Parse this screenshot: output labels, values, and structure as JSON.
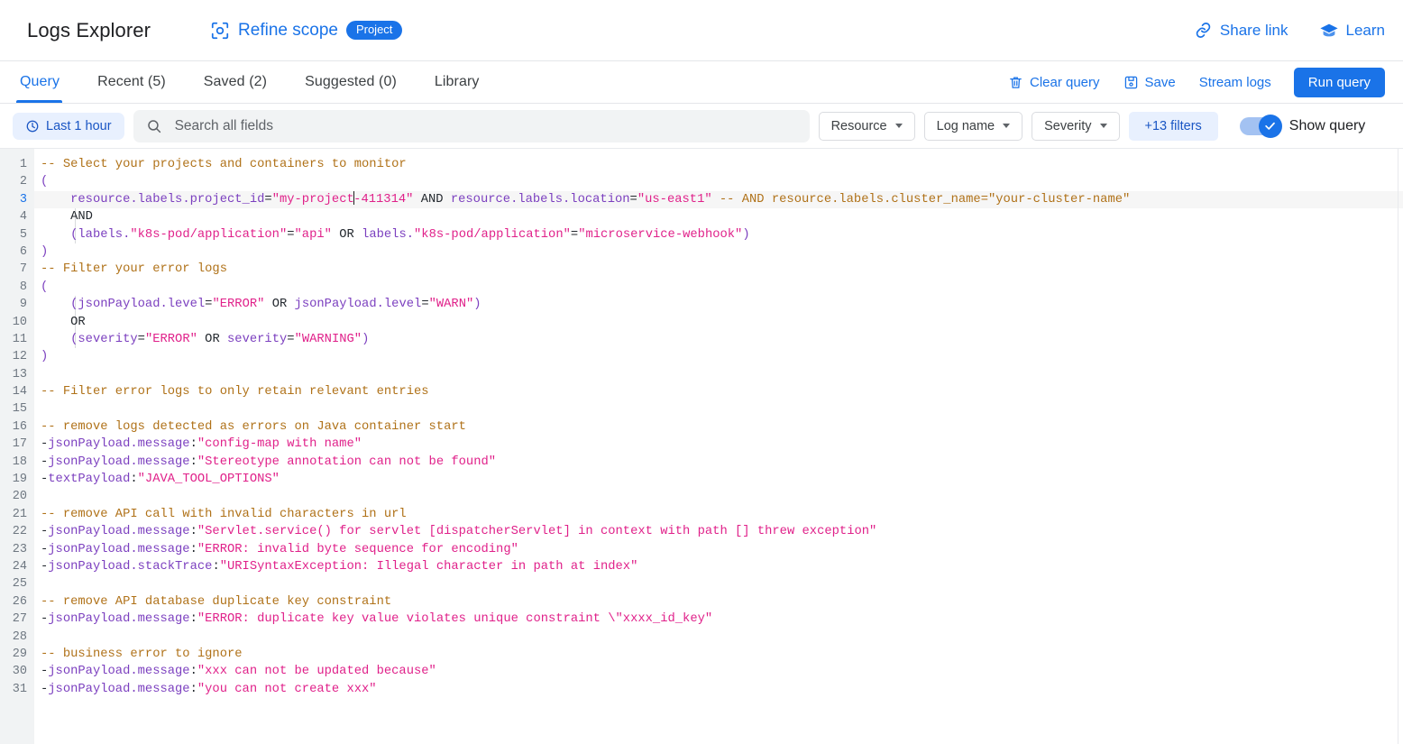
{
  "header": {
    "app_title": "Logs Explorer",
    "refine_scope_label": "Refine scope",
    "refine_scope_icon": "focus-target-icon",
    "scope_chip": "Project",
    "share_link": "Share link",
    "share_link_icon": "link-icon",
    "learn": "Learn",
    "learn_icon": "graduation-cap-icon"
  },
  "tabbar": {
    "tabs": [
      {
        "label": "Query",
        "active": true
      },
      {
        "label": "Recent (5)",
        "active": false
      },
      {
        "label": "Saved (2)",
        "active": false
      },
      {
        "label": "Suggested (0)",
        "active": false
      },
      {
        "label": "Library",
        "active": false
      }
    ],
    "clear_query": "Clear query",
    "clear_query_icon": "trash-icon",
    "save": "Save",
    "save_icon": "save-disk-icon",
    "stream_logs": "Stream logs",
    "run_query": "Run query"
  },
  "filterbar": {
    "time_range": "Last 1 hour",
    "time_range_icon": "clock-icon",
    "search_placeholder": "Search all fields",
    "search_value": "",
    "search_icon": "search-icon",
    "resource": "Resource",
    "log_name": "Log name",
    "severity": "Severity",
    "more_filters": "+13 filters",
    "show_query_label": "Show query",
    "show_query_on": true
  },
  "colors": {
    "accent": "#1a73e8",
    "chip_bg": "#e8f0fe",
    "comment": "#b07219",
    "field": "#7b3fbf",
    "string": "#e0218a",
    "gutter_bg": "#f1f3f4"
  },
  "editor": {
    "active_line": 3,
    "total_lines": 31,
    "lines": [
      {
        "n": 1,
        "tokens": [
          {
            "t": "comment",
            "v": "-- Select your projects and containers to monitor"
          }
        ]
      },
      {
        "n": 2,
        "tokens": [
          {
            "t": "paren",
            "v": "("
          }
        ]
      },
      {
        "n": 3,
        "tokens": [
          {
            "t": "op",
            "v": "    "
          },
          {
            "t": "field",
            "v": "resource.labels.project_id"
          },
          {
            "t": "op",
            "v": "="
          },
          {
            "t": "string",
            "v": "\"my-project"
          },
          {
            "t": "caret",
            "v": ""
          },
          {
            "t": "string",
            "v": "-411314\""
          },
          {
            "t": "op",
            "v": " AND "
          },
          {
            "t": "field",
            "v": "resource.labels.location"
          },
          {
            "t": "op",
            "v": "="
          },
          {
            "t": "string",
            "v": "\"us-east1\""
          },
          {
            "t": "op",
            "v": " "
          },
          {
            "t": "comment",
            "v": "-- AND resource.labels.cluster_name=\"your-cluster-name\""
          }
        ]
      },
      {
        "n": 4,
        "tokens": [
          {
            "t": "op",
            "v": "    AND"
          }
        ]
      },
      {
        "n": 5,
        "tokens": [
          {
            "t": "op",
            "v": "    "
          },
          {
            "t": "paren",
            "v": "("
          },
          {
            "t": "field",
            "v": "labels."
          },
          {
            "t": "string",
            "v": "\"k8s-pod/application\""
          },
          {
            "t": "op",
            "v": "="
          },
          {
            "t": "string",
            "v": "\"api\""
          },
          {
            "t": "op",
            "v": " OR "
          },
          {
            "t": "field",
            "v": "labels."
          },
          {
            "t": "string",
            "v": "\"k8s-pod/application\""
          },
          {
            "t": "op",
            "v": "="
          },
          {
            "t": "string",
            "v": "\"microservice-webhook\""
          },
          {
            "t": "paren",
            "v": ")"
          }
        ]
      },
      {
        "n": 6,
        "tokens": [
          {
            "t": "paren",
            "v": ")"
          }
        ]
      },
      {
        "n": 7,
        "tokens": [
          {
            "t": "comment",
            "v": "-- Filter your error logs"
          }
        ]
      },
      {
        "n": 8,
        "tokens": [
          {
            "t": "paren",
            "v": "("
          }
        ]
      },
      {
        "n": 9,
        "tokens": [
          {
            "t": "op",
            "v": "    "
          },
          {
            "t": "paren",
            "v": "("
          },
          {
            "t": "field",
            "v": "jsonPayload.level"
          },
          {
            "t": "op",
            "v": "="
          },
          {
            "t": "string",
            "v": "\"ERROR\""
          },
          {
            "t": "op",
            "v": " OR "
          },
          {
            "t": "field",
            "v": "jsonPayload.level"
          },
          {
            "t": "op",
            "v": "="
          },
          {
            "t": "string",
            "v": "\"WARN\""
          },
          {
            "t": "paren",
            "v": ")"
          }
        ]
      },
      {
        "n": 10,
        "tokens": [
          {
            "t": "op",
            "v": "    OR"
          }
        ]
      },
      {
        "n": 11,
        "tokens": [
          {
            "t": "op",
            "v": "    "
          },
          {
            "t": "paren",
            "v": "("
          },
          {
            "t": "field",
            "v": "severity"
          },
          {
            "t": "op",
            "v": "="
          },
          {
            "t": "string",
            "v": "\"ERROR\""
          },
          {
            "t": "op",
            "v": " OR "
          },
          {
            "t": "field",
            "v": "severity"
          },
          {
            "t": "op",
            "v": "="
          },
          {
            "t": "string",
            "v": "\"WARNING\""
          },
          {
            "t": "paren",
            "v": ")"
          }
        ]
      },
      {
        "n": 12,
        "tokens": [
          {
            "t": "paren",
            "v": ")"
          }
        ]
      },
      {
        "n": 13,
        "tokens": []
      },
      {
        "n": 14,
        "tokens": [
          {
            "t": "comment",
            "v": "-- Filter error logs to only retain relevant entries"
          }
        ]
      },
      {
        "n": 15,
        "tokens": []
      },
      {
        "n": 16,
        "tokens": [
          {
            "t": "comment",
            "v": "-- remove logs detected as errors on Java container start"
          }
        ]
      },
      {
        "n": 17,
        "tokens": [
          {
            "t": "op",
            "v": "-"
          },
          {
            "t": "field",
            "v": "jsonPayload.message"
          },
          {
            "t": "op",
            "v": ":"
          },
          {
            "t": "string",
            "v": "\"config-map with name\""
          }
        ]
      },
      {
        "n": 18,
        "tokens": [
          {
            "t": "op",
            "v": "-"
          },
          {
            "t": "field",
            "v": "jsonPayload.message"
          },
          {
            "t": "op",
            "v": ":"
          },
          {
            "t": "string",
            "v": "\"Stereotype annotation can not be found\""
          }
        ]
      },
      {
        "n": 19,
        "tokens": [
          {
            "t": "op",
            "v": "-"
          },
          {
            "t": "field",
            "v": "textPayload"
          },
          {
            "t": "op",
            "v": ":"
          },
          {
            "t": "string",
            "v": "\"JAVA_TOOL_OPTIONS\""
          }
        ]
      },
      {
        "n": 20,
        "tokens": []
      },
      {
        "n": 21,
        "tokens": [
          {
            "t": "comment",
            "v": "-- remove API call with invalid characters in url"
          }
        ]
      },
      {
        "n": 22,
        "tokens": [
          {
            "t": "op",
            "v": "-"
          },
          {
            "t": "field",
            "v": "jsonPayload.message"
          },
          {
            "t": "op",
            "v": ":"
          },
          {
            "t": "string",
            "v": "\"Servlet.service() for servlet [dispatcherServlet] in context with path [] threw exception\""
          }
        ]
      },
      {
        "n": 23,
        "tokens": [
          {
            "t": "op",
            "v": "-"
          },
          {
            "t": "field",
            "v": "jsonPayload.message"
          },
          {
            "t": "op",
            "v": ":"
          },
          {
            "t": "string",
            "v": "\"ERROR: invalid byte sequence for encoding\""
          }
        ]
      },
      {
        "n": 24,
        "tokens": [
          {
            "t": "op",
            "v": "-"
          },
          {
            "t": "field",
            "v": "jsonPayload.stackTrace"
          },
          {
            "t": "op",
            "v": ":"
          },
          {
            "t": "string",
            "v": "\"URISyntaxException: Illegal character in path at index\""
          }
        ]
      },
      {
        "n": 25,
        "tokens": []
      },
      {
        "n": 26,
        "tokens": [
          {
            "t": "comment",
            "v": "-- remove API database duplicate key constraint"
          }
        ]
      },
      {
        "n": 27,
        "tokens": [
          {
            "t": "op",
            "v": "-"
          },
          {
            "t": "field",
            "v": "jsonPayload.message"
          },
          {
            "t": "op",
            "v": ":"
          },
          {
            "t": "string",
            "v": "\"ERROR: duplicate key value violates unique constraint \\\"xxxx_id_key\""
          }
        ]
      },
      {
        "n": 28,
        "tokens": []
      },
      {
        "n": 29,
        "tokens": [
          {
            "t": "comment",
            "v": "-- business error to ignore"
          }
        ]
      },
      {
        "n": 30,
        "tokens": [
          {
            "t": "op",
            "v": "-"
          },
          {
            "t": "field",
            "v": "jsonPayload.message"
          },
          {
            "t": "op",
            "v": ":"
          },
          {
            "t": "string",
            "v": "\"xxx can not be updated because\""
          }
        ]
      },
      {
        "n": 31,
        "tokens": [
          {
            "t": "op",
            "v": "-"
          },
          {
            "t": "field",
            "v": "jsonPayload.message"
          },
          {
            "t": "op",
            "v": ":"
          },
          {
            "t": "string",
            "v": "\"you can not create xxx\""
          }
        ]
      }
    ]
  }
}
